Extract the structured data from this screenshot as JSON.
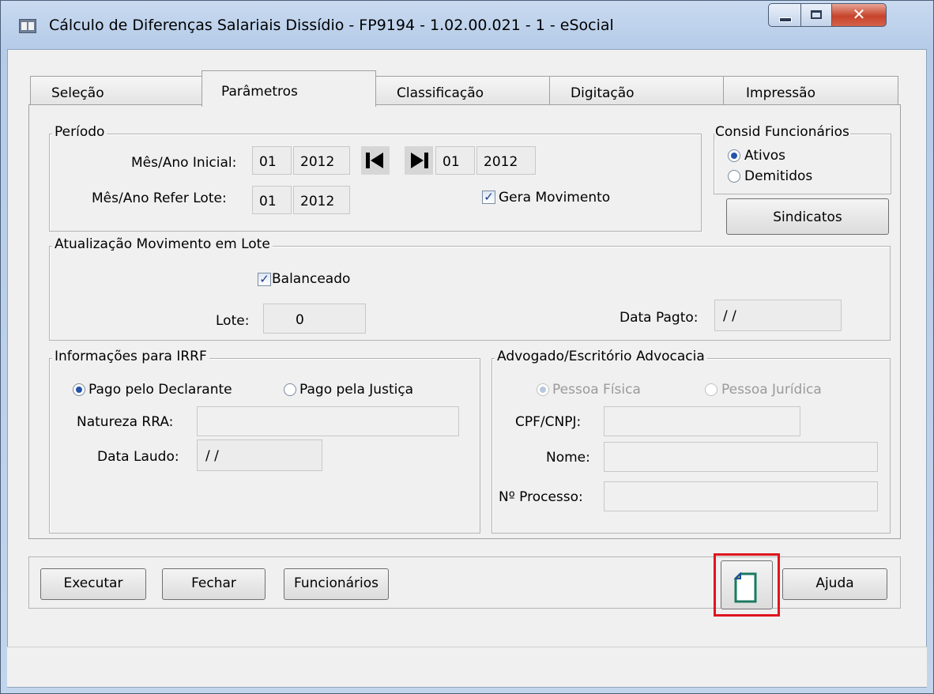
{
  "window": {
    "title": "Cálculo de Diferenças Salariais Dissídio - FP9194 - 1.02.00.021 - 1 - eSocial",
    "controls": [
      "minimize-icon",
      "maximize-icon",
      "close-icon"
    ]
  },
  "tabs": [
    {
      "label": "Seleção",
      "active": false
    },
    {
      "label": "Parâmetros",
      "active": true
    },
    {
      "label": "Classificação",
      "active": false
    },
    {
      "label": "Digitação",
      "active": false
    },
    {
      "label": "Impressão",
      "active": false
    }
  ],
  "periodo": {
    "legend": "Período",
    "mes_ano_inicial_label": "Mês/Ano Inicial:",
    "mes_inicial": "01",
    "ano_inicial": "2012",
    "mes_final": "01",
    "ano_final": "2012",
    "mes_ano_refer_label": "Mês/Ano Refer Lote:",
    "mes_refer": "01",
    "ano_refer": "2012",
    "gera_movimento_label": "Gera Movimento",
    "gera_movimento_checked": true
  },
  "consid": {
    "legend": "Consid Funcionários",
    "ativos_label": "Ativos",
    "demitidos_label": "Demitidos",
    "selected": "Ativos"
  },
  "sindicatos_label": "Sindicatos",
  "atualizacao": {
    "legend": "Atualização Movimento em Lote",
    "balanceado_label": "Balanceado",
    "balanceado_checked": true,
    "lote_label": "Lote:",
    "lote_value": "0",
    "data_pagto_label": "Data Pagto:",
    "data_pagto_value": " / /"
  },
  "irrf": {
    "legend": "Informações para IRRF",
    "pago_declarante_label": "Pago pelo Declarante",
    "pago_justica_label": "Pago pela Justiça",
    "selected": "Pago pelo Declarante",
    "natureza_label": "Natureza RRA:",
    "natureza_value": "",
    "data_laudo_label": "Data Laudo:",
    "data_laudo_value": " / /"
  },
  "advogado": {
    "legend": "Advogado/Escritório Advocacia",
    "pessoa_fisica_label": "Pessoa Física",
    "pessoa_juridica_label": "Pessoa Jurídica",
    "selected": "Pessoa Física",
    "cpf_label": "CPF/CNPJ:",
    "cpf_value": "",
    "nome_label": "Nome:",
    "nome_value": "",
    "processo_label": "Nº Processo:",
    "processo_value": ""
  },
  "buttons": {
    "executar": "Executar",
    "fechar": "Fechar",
    "funcionarios": "Funcionários",
    "ajuda": "Ajuda",
    "document_icon": "document-icon"
  },
  "colors": {
    "highlight_border": "#e0141e",
    "radio_selected": "#2454a8",
    "close_button": "#c7442b"
  }
}
